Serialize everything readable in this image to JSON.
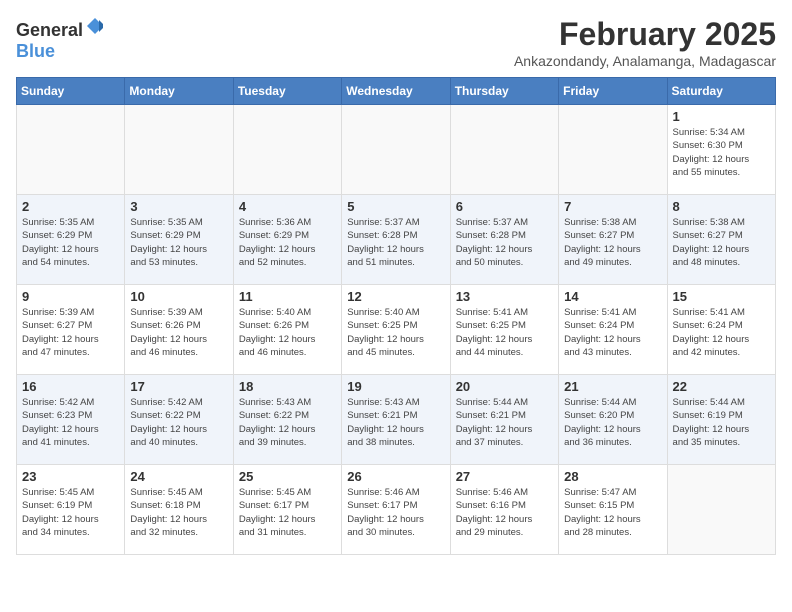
{
  "header": {
    "logo_general": "General",
    "logo_blue": "Blue",
    "month_title": "February 2025",
    "subtitle": "Ankazondandy, Analamanga, Madagascar"
  },
  "weekdays": [
    "Sunday",
    "Monday",
    "Tuesday",
    "Wednesday",
    "Thursday",
    "Friday",
    "Saturday"
  ],
  "weeks": [
    [
      {
        "day": "",
        "info": ""
      },
      {
        "day": "",
        "info": ""
      },
      {
        "day": "",
        "info": ""
      },
      {
        "day": "",
        "info": ""
      },
      {
        "day": "",
        "info": ""
      },
      {
        "day": "",
        "info": ""
      },
      {
        "day": "1",
        "info": "Sunrise: 5:34 AM\nSunset: 6:30 PM\nDaylight: 12 hours\nand 55 minutes."
      }
    ],
    [
      {
        "day": "2",
        "info": "Sunrise: 5:35 AM\nSunset: 6:29 PM\nDaylight: 12 hours\nand 54 minutes."
      },
      {
        "day": "3",
        "info": "Sunrise: 5:35 AM\nSunset: 6:29 PM\nDaylight: 12 hours\nand 53 minutes."
      },
      {
        "day": "4",
        "info": "Sunrise: 5:36 AM\nSunset: 6:29 PM\nDaylight: 12 hours\nand 52 minutes."
      },
      {
        "day": "5",
        "info": "Sunrise: 5:37 AM\nSunset: 6:28 PM\nDaylight: 12 hours\nand 51 minutes."
      },
      {
        "day": "6",
        "info": "Sunrise: 5:37 AM\nSunset: 6:28 PM\nDaylight: 12 hours\nand 50 minutes."
      },
      {
        "day": "7",
        "info": "Sunrise: 5:38 AM\nSunset: 6:27 PM\nDaylight: 12 hours\nand 49 minutes."
      },
      {
        "day": "8",
        "info": "Sunrise: 5:38 AM\nSunset: 6:27 PM\nDaylight: 12 hours\nand 48 minutes."
      }
    ],
    [
      {
        "day": "9",
        "info": "Sunrise: 5:39 AM\nSunset: 6:27 PM\nDaylight: 12 hours\nand 47 minutes."
      },
      {
        "day": "10",
        "info": "Sunrise: 5:39 AM\nSunset: 6:26 PM\nDaylight: 12 hours\nand 46 minutes."
      },
      {
        "day": "11",
        "info": "Sunrise: 5:40 AM\nSunset: 6:26 PM\nDaylight: 12 hours\nand 46 minutes."
      },
      {
        "day": "12",
        "info": "Sunrise: 5:40 AM\nSunset: 6:25 PM\nDaylight: 12 hours\nand 45 minutes."
      },
      {
        "day": "13",
        "info": "Sunrise: 5:41 AM\nSunset: 6:25 PM\nDaylight: 12 hours\nand 44 minutes."
      },
      {
        "day": "14",
        "info": "Sunrise: 5:41 AM\nSunset: 6:24 PM\nDaylight: 12 hours\nand 43 minutes."
      },
      {
        "day": "15",
        "info": "Sunrise: 5:41 AM\nSunset: 6:24 PM\nDaylight: 12 hours\nand 42 minutes."
      }
    ],
    [
      {
        "day": "16",
        "info": "Sunrise: 5:42 AM\nSunset: 6:23 PM\nDaylight: 12 hours\nand 41 minutes."
      },
      {
        "day": "17",
        "info": "Sunrise: 5:42 AM\nSunset: 6:22 PM\nDaylight: 12 hours\nand 40 minutes."
      },
      {
        "day": "18",
        "info": "Sunrise: 5:43 AM\nSunset: 6:22 PM\nDaylight: 12 hours\nand 39 minutes."
      },
      {
        "day": "19",
        "info": "Sunrise: 5:43 AM\nSunset: 6:21 PM\nDaylight: 12 hours\nand 38 minutes."
      },
      {
        "day": "20",
        "info": "Sunrise: 5:44 AM\nSunset: 6:21 PM\nDaylight: 12 hours\nand 37 minutes."
      },
      {
        "day": "21",
        "info": "Sunrise: 5:44 AM\nSunset: 6:20 PM\nDaylight: 12 hours\nand 36 minutes."
      },
      {
        "day": "22",
        "info": "Sunrise: 5:44 AM\nSunset: 6:19 PM\nDaylight: 12 hours\nand 35 minutes."
      }
    ],
    [
      {
        "day": "23",
        "info": "Sunrise: 5:45 AM\nSunset: 6:19 PM\nDaylight: 12 hours\nand 34 minutes."
      },
      {
        "day": "24",
        "info": "Sunrise: 5:45 AM\nSunset: 6:18 PM\nDaylight: 12 hours\nand 32 minutes."
      },
      {
        "day": "25",
        "info": "Sunrise: 5:45 AM\nSunset: 6:17 PM\nDaylight: 12 hours\nand 31 minutes."
      },
      {
        "day": "26",
        "info": "Sunrise: 5:46 AM\nSunset: 6:17 PM\nDaylight: 12 hours\nand 30 minutes."
      },
      {
        "day": "27",
        "info": "Sunrise: 5:46 AM\nSunset: 6:16 PM\nDaylight: 12 hours\nand 29 minutes."
      },
      {
        "day": "28",
        "info": "Sunrise: 5:47 AM\nSunset: 6:15 PM\nDaylight: 12 hours\nand 28 minutes."
      },
      {
        "day": "",
        "info": ""
      }
    ]
  ]
}
